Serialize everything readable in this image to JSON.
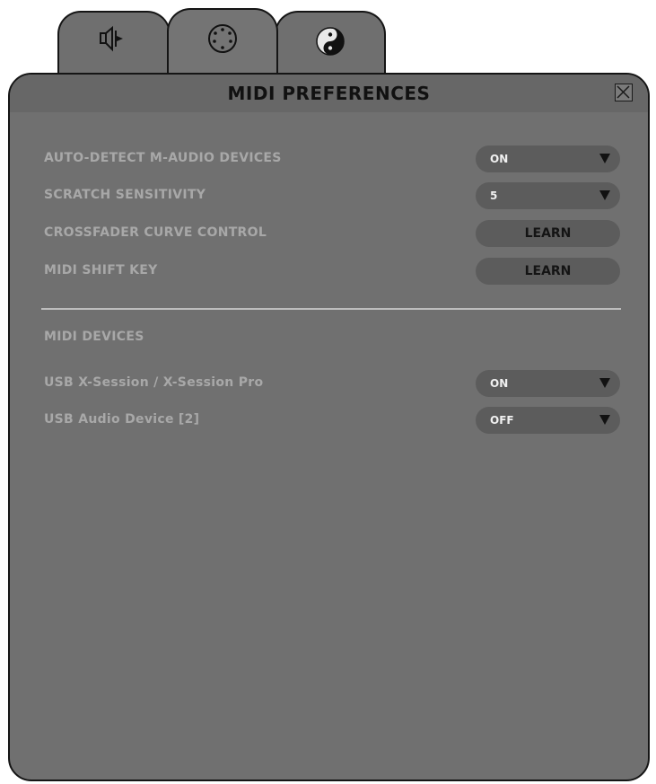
{
  "window": {
    "title": "MIDI PREFERENCES"
  },
  "tabs": [
    {
      "name": "audio",
      "icon": "speaker-icon",
      "active": false
    },
    {
      "name": "midi",
      "icon": "midi-port-icon",
      "active": true
    },
    {
      "name": "skin",
      "icon": "yin-yang-icon",
      "active": false
    }
  ],
  "settings": {
    "auto_detect": {
      "label": "AUTO-DETECT M-AUDIO DEVICES",
      "value": "ON"
    },
    "scratch": {
      "label": "SCRATCH SENSITIVITY",
      "value": "5"
    },
    "crossfader": {
      "label": "CROSSFADER CURVE CONTROL",
      "button": "LEARN"
    },
    "shift_key": {
      "label": "MIDI SHIFT KEY",
      "button": "LEARN"
    }
  },
  "devices": {
    "heading": "MIDI DEVICES",
    "items": [
      {
        "label": "USB X-Session / X-Session Pro",
        "value": "ON"
      },
      {
        "label": "USB Audio Device [2]",
        "value": "OFF"
      }
    ]
  }
}
